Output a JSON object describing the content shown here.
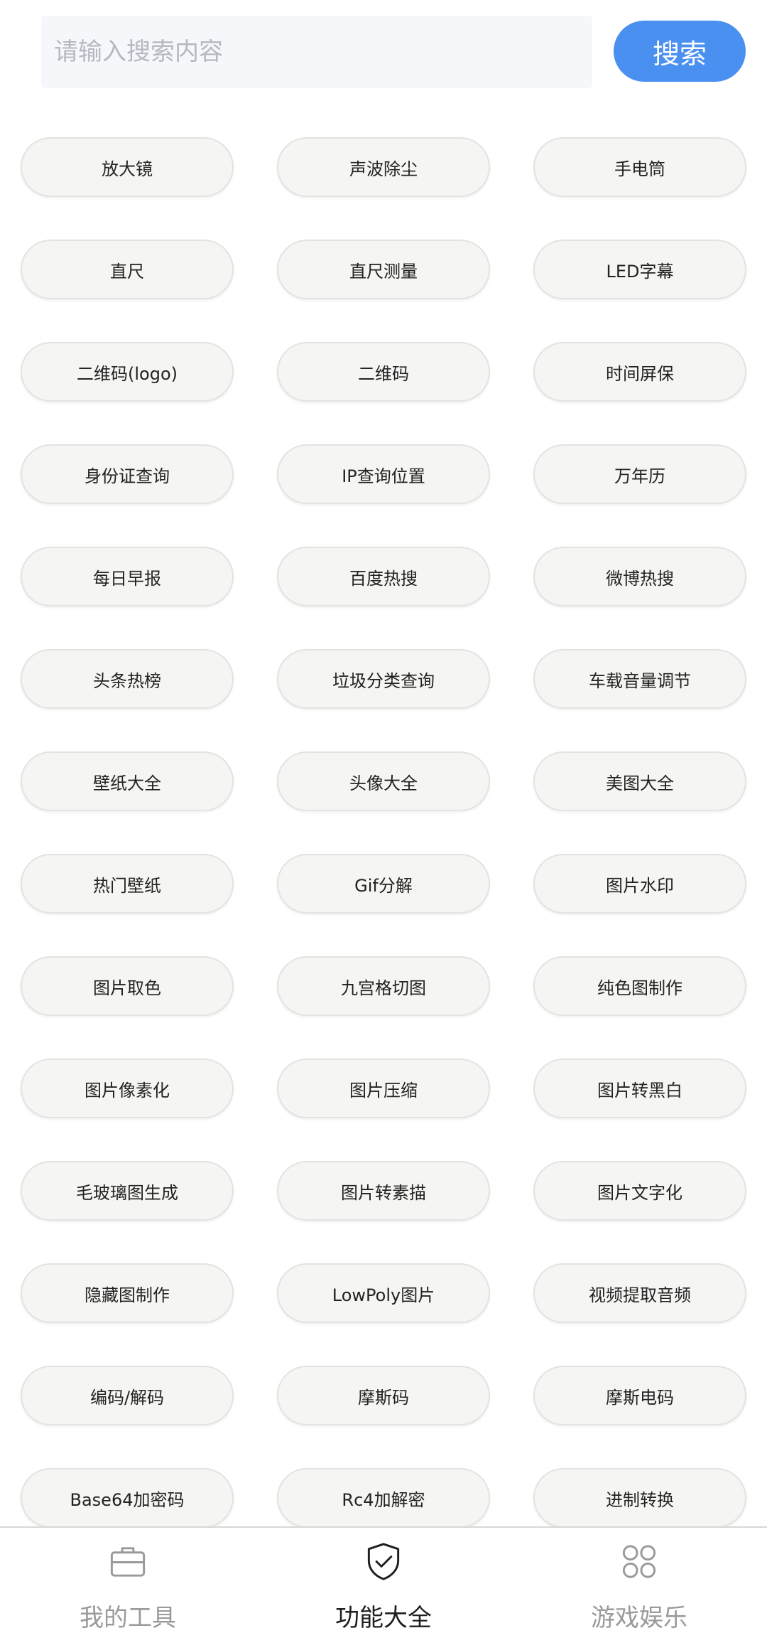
{
  "search": {
    "placeholder": "请输入搜索内容",
    "value": "",
    "button_label": "搜索"
  },
  "tools": [
    "放大镜",
    "声波除尘",
    "手电筒",
    "直尺",
    "直尺测量",
    "LED字幕",
    "二维码(logo)",
    "二维码",
    "时间屏保",
    "身份证查询",
    "IP查询位置",
    "万年历",
    "每日早报",
    "百度热搜",
    "微博热搜",
    "头条热榜",
    "垃圾分类查询",
    "车载音量调节",
    "壁纸大全",
    "头像大全",
    "美图大全",
    "热门壁纸",
    "Gif分解",
    "图片水印",
    "图片取色",
    "九宫格切图",
    "纯色图制作",
    "图片像素化",
    "图片压缩",
    "图片转黑白",
    "毛玻璃图生成",
    "图片转素描",
    "图片文字化",
    "隐藏图制作",
    "LowPoly图片",
    "视频提取音频",
    "编码/解码",
    "摩斯码",
    "摩斯电码",
    "Base64加密码",
    "Rc4加解密",
    "进制转换"
  ],
  "nav": {
    "items": [
      {
        "label": "我的工具",
        "icon": "briefcase-icon",
        "active": false
      },
      {
        "label": "功能大全",
        "icon": "shield-check-icon",
        "active": true
      },
      {
        "label": "游戏娱乐",
        "icon": "grid-apps-icon",
        "active": false
      }
    ]
  },
  "colors": {
    "accent": "#4a90f0",
    "pill_background": "#f5f6f3",
    "pill_border": "#e2e4e0",
    "nav_inactive": "#9a9a9a",
    "nav_active": "#1f1f1f"
  }
}
